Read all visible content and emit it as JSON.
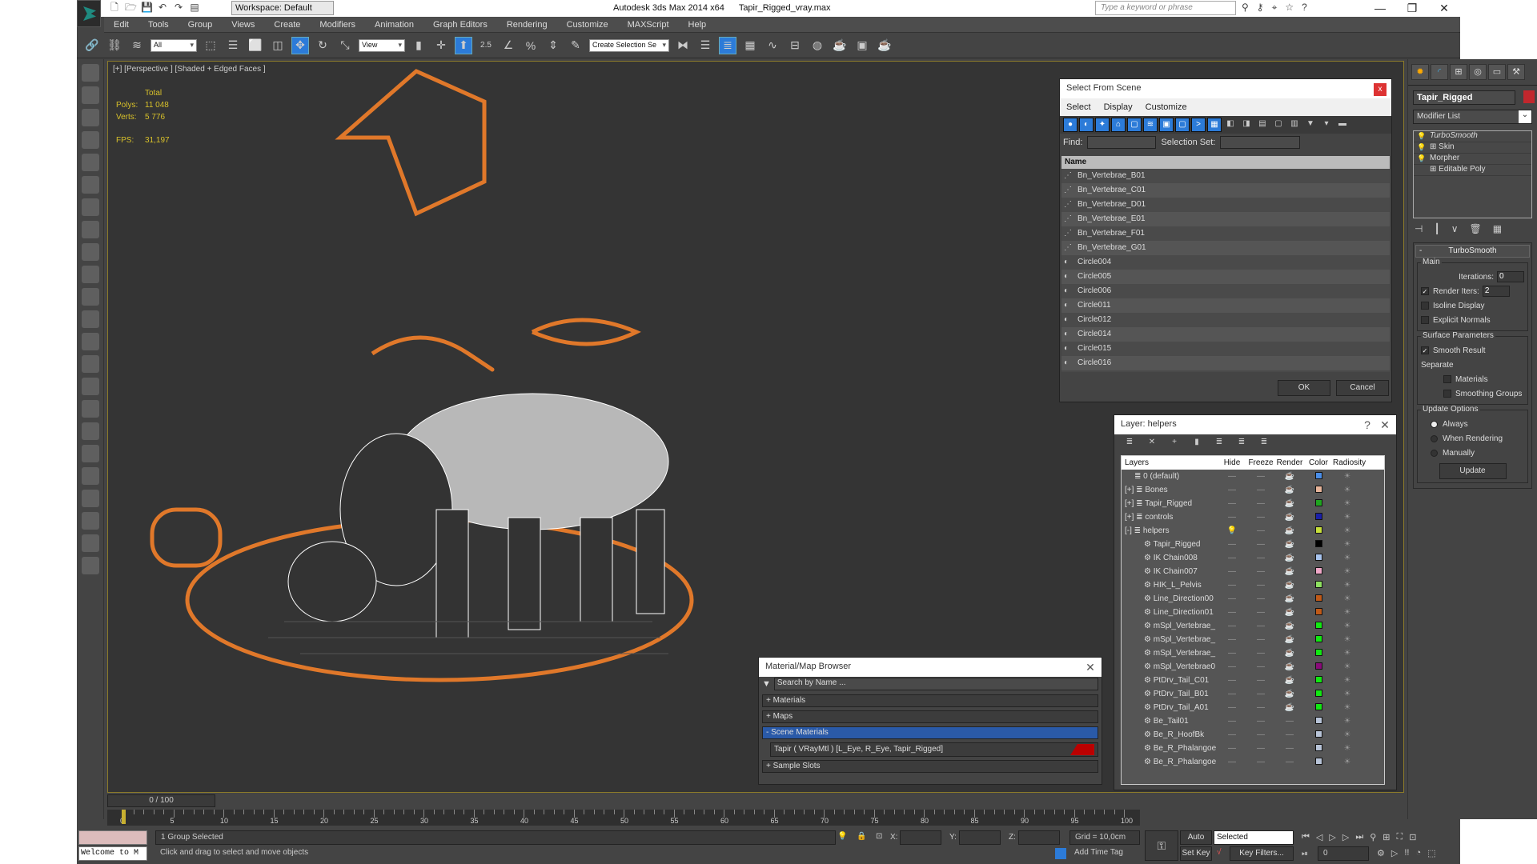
{
  "titlebar": {
    "workspace": "Workspace: Default",
    "app": "Autodesk 3ds Max  2014 x64",
    "file": "Tapir_Rigged_vray.max",
    "search_placeholder": "Type a keyword or phrase"
  },
  "menu": [
    "Edit",
    "Tools",
    "Group",
    "Views",
    "Create",
    "Modifiers",
    "Animation",
    "Graph Editors",
    "Rendering",
    "Customize",
    "MAXScript",
    "Help"
  ],
  "toolbar": {
    "filter": "All",
    "coord": "View",
    "snap": "2.5",
    "selection_set": "Create Selection Se"
  },
  "viewport": {
    "label": "[+] [Perspective ] [Shaded + Edged Faces ]",
    "stats": {
      "header": "Total",
      "polys_label": "Polys:",
      "polys": "11 048",
      "verts_label": "Verts:",
      "verts": "5 776",
      "fps_label": "FPS:",
      "fps": "31,197"
    }
  },
  "select_from_scene": {
    "title": "Select From Scene",
    "menu": [
      "Select",
      "Display",
      "Customize"
    ],
    "find_label": "Find:",
    "selset_label": "Selection Set:",
    "column": "Name",
    "items": [
      {
        "name": "Bn_Vertebrae_B01",
        "type": "bone"
      },
      {
        "name": "Bn_Vertebrae_C01",
        "type": "bone"
      },
      {
        "name": "Bn_Vertebrae_D01",
        "type": "bone"
      },
      {
        "name": "Bn_Vertebrae_E01",
        "type": "bone"
      },
      {
        "name": "Bn_Vertebrae_F01",
        "type": "bone"
      },
      {
        "name": "Bn_Vertebrae_G01",
        "type": "bone"
      },
      {
        "name": "Circle004",
        "type": "shape"
      },
      {
        "name": "Circle005",
        "type": "shape"
      },
      {
        "name": "Circle006",
        "type": "shape"
      },
      {
        "name": "Circle011",
        "type": "shape"
      },
      {
        "name": "Circle012",
        "type": "shape"
      },
      {
        "name": "Circle014",
        "type": "shape"
      },
      {
        "name": "Circle015",
        "type": "shape"
      },
      {
        "name": "Circle016",
        "type": "shape"
      }
    ],
    "ok": "OK",
    "cancel": "Cancel"
  },
  "layer_dialog": {
    "title": "Layer: helpers",
    "help": "?",
    "columns": [
      "Layers",
      "Hide",
      "Freeze",
      "Render",
      "Color",
      "Radiosity"
    ],
    "rows": [
      {
        "name": "0 (default)",
        "color": "#4a8ee8",
        "level": 0,
        "expand": ""
      },
      {
        "name": "Bones",
        "color": "#e8b59a",
        "level": 0,
        "expand": "+"
      },
      {
        "name": "Tapir_Rigged",
        "color": "#1fa51f",
        "level": 0,
        "expand": "+"
      },
      {
        "name": "controls",
        "color": "#1a1fa8",
        "level": 0,
        "expand": "+"
      },
      {
        "name": "helpers",
        "color": "#c8e03a",
        "level": 0,
        "expand": "-",
        "active": true
      },
      {
        "name": "Tapir_Rigged",
        "color": "#000000",
        "level": 1
      },
      {
        "name": "IK Chain008",
        "color": "#a8c4ee",
        "level": 1
      },
      {
        "name": "IK Chain007",
        "color": "#f0a8c8",
        "level": 1
      },
      {
        "name": "HIK_L_Pelvis",
        "color": "#8ee060",
        "level": 1
      },
      {
        "name": "Line_Direction00",
        "color": "#c05a18",
        "level": 1
      },
      {
        "name": "Line_Direction01",
        "color": "#c05a18",
        "level": 1
      },
      {
        "name": "mSpl_Vertebrae_",
        "color": "#12e812",
        "level": 1
      },
      {
        "name": "mSpl_Vertebrae_",
        "color": "#12e812",
        "level": 1
      },
      {
        "name": "mSpl_Vertebrae_",
        "color": "#12e812",
        "level": 1
      },
      {
        "name": "mSpl_Vertebrae0",
        "color": "#8a0a7a",
        "level": 1
      },
      {
        "name": "PtDrv_Tail_C01",
        "color": "#12e812",
        "level": 1
      },
      {
        "name": "PtDrv_Tail_B01",
        "color": "#12e812",
        "level": 1
      },
      {
        "name": "PtDrv_Tail_A01",
        "color": "#12e812",
        "level": 1
      },
      {
        "name": "Be_Tail01",
        "color": "#b8c4d8",
        "level": 1,
        "norender": true
      },
      {
        "name": "Be_R_HoofBk",
        "color": "#b8c4d8",
        "level": 1,
        "norender": true
      },
      {
        "name": "Be_R_Phalangoe",
        "color": "#b8c4d8",
        "level": 1,
        "norender": true
      },
      {
        "name": "Be_R_Phalangoe",
        "color": "#b8c4d8",
        "level": 1,
        "norender": true
      }
    ]
  },
  "material_browser": {
    "title": "Material/Map Browser",
    "search_placeholder": "Search by Name ...",
    "sections": [
      {
        "label": "+ Materials"
      },
      {
        "label": "+ Maps"
      },
      {
        "label": "- Scene Materials",
        "active": true
      }
    ],
    "scene_material": "Tapir  ( VRayMtl ) [L_Eye, R_Eye, Tapir_Rigged]",
    "sample_slots": "+ Sample Slots"
  },
  "command_panel": {
    "object_name": "Tapir_Rigged",
    "object_color": "#c2272d",
    "modifier_list": "Modifier List",
    "stack": [
      {
        "name": "TurboSmooth",
        "italic": true,
        "bulb": true
      },
      {
        "name": "Skin",
        "bulb": true,
        "plus": true
      },
      {
        "name": "Morpher",
        "bulb": true
      },
      {
        "name": "Editable Poly",
        "plus": true
      }
    ],
    "turbosmooth": {
      "title": "TurboSmooth",
      "main": "Main",
      "iterations_label": "Iterations:",
      "iterations": "0",
      "render_iters_label": "Render Iters:",
      "render_iters": "2",
      "render_iters_checked": true,
      "isoline": "Isoline Display",
      "explicit": "Explicit Normals",
      "surface": "Surface Parameters",
      "smooth_result": "Smooth Result",
      "separate": "Separate",
      "materials": "Materials",
      "smoothing_groups": "Smoothing Groups",
      "update_options": "Update Options",
      "always": "Always",
      "when_rendering": "When Rendering",
      "manually": "Manually",
      "update": "Update"
    }
  },
  "timeline": {
    "frame": "0 / 100",
    "ticks": [
      "0",
      "5",
      "10",
      "15",
      "20",
      "25",
      "30",
      "35",
      "40",
      "45",
      "50",
      "55",
      "60",
      "65",
      "70",
      "75",
      "80",
      "85",
      "90",
      "95",
      "100"
    ],
    "current": 0,
    "total": 100
  },
  "status": {
    "maxscript": "Welcome to M",
    "selected": "1 Group Selected",
    "prompt": "Click and drag to select and move objects",
    "x_label": "X:",
    "y_label": "Y:",
    "z_label": "Z:",
    "grid": "Grid = 10,0cm",
    "add_time_tag": "Add Time Tag",
    "auto_key": "Auto Key",
    "set_key": "Set Key",
    "key_mode": "Selected",
    "key_filters": "Key Filters...",
    "frame_value": "0"
  }
}
